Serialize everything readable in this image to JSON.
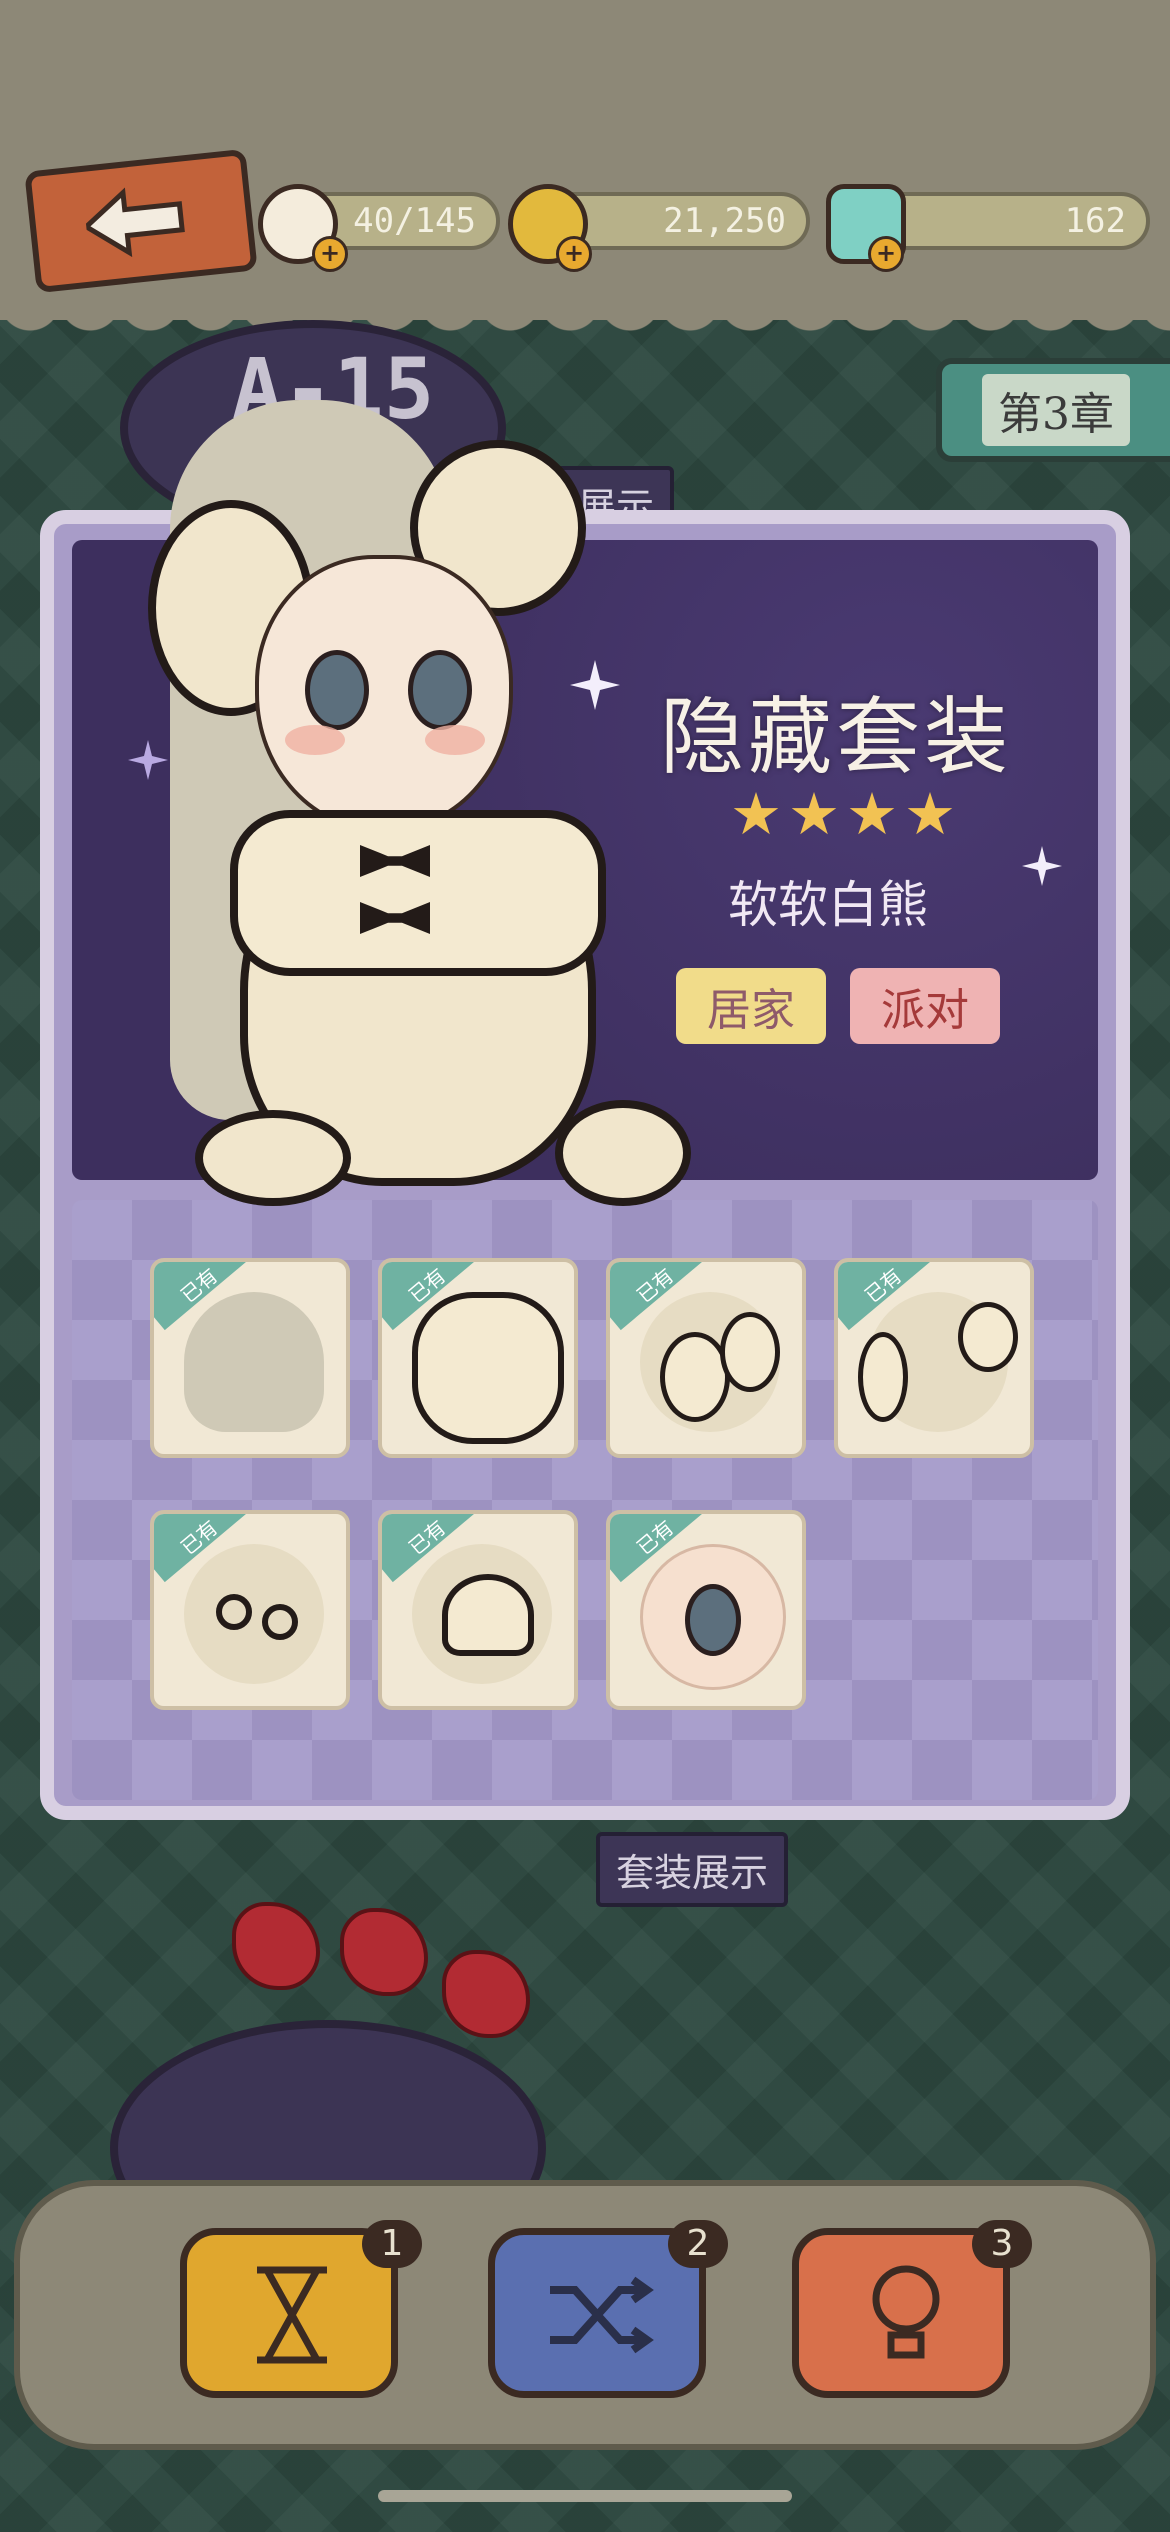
{
  "header": {
    "back_label": "back",
    "resources": [
      {
        "name": "cake",
        "value": "40/145",
        "color": "#f4f1e2"
      },
      {
        "name": "coin",
        "value": "21,250",
        "color": "#e2b93d"
      },
      {
        "name": "gem",
        "value": "162",
        "color": "#7fd0c4"
      }
    ]
  },
  "chapter": {
    "label": "第3章"
  },
  "level": {
    "label": "A-15",
    "tab_partial": "装展示"
  },
  "outfit": {
    "title": "隐藏套装",
    "stars": "★★★★",
    "name": "软软白熊",
    "tags": [
      "居家",
      "派对"
    ]
  },
  "items": {
    "owned_label": "已有",
    "slots": [
      "hair",
      "top",
      "ear-puffs",
      "hand-puffs",
      "earrings",
      "shoes",
      "eyes"
    ]
  },
  "show_button": {
    "label": "套装展示"
  },
  "tools": [
    {
      "name": "hourglass",
      "count": "1"
    },
    {
      "name": "shuffle",
      "count": "2"
    },
    {
      "name": "hint",
      "count": "3"
    }
  ]
}
